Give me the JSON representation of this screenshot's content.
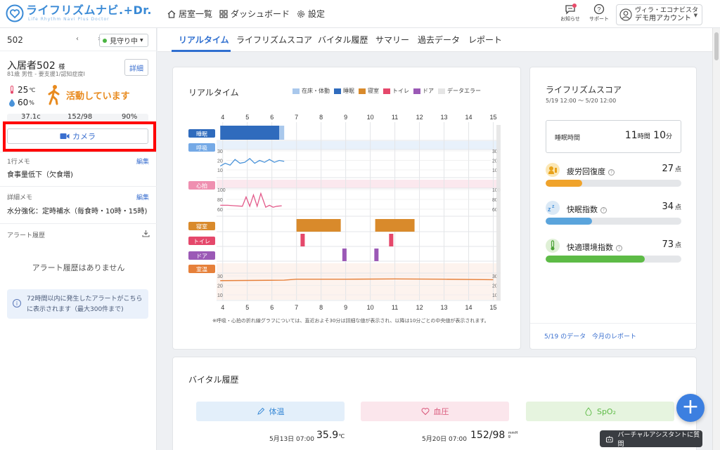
{
  "header": {
    "logo_main": "ライフリズムナビ.+Dr.",
    "logo_sub": "Life Rhythm Navi Plus Doctor",
    "nav": [
      {
        "label": "居室一覧",
        "icon": "home-icon"
      },
      {
        "label": "ダッシュボード",
        "icon": "grid-icon"
      },
      {
        "label": "設定",
        "icon": "gear-icon"
      }
    ],
    "notice_label": "お知らせ",
    "support_label": "サポート",
    "account_line1": "ヴィラ・エコナビスタ",
    "account_line2": "デモ用アカウント"
  },
  "sidebar": {
    "room_no": "502",
    "arrows": "‹ ›",
    "watch_status": "見守り中",
    "resident_name": "入居者502",
    "resident_suffix": "様",
    "resident_info": "81歳 男性 - 要支援1/認知症度I",
    "detail_label": "詳細",
    "temp_value": "25",
    "temp_unit": "℃",
    "humidity_value": "60",
    "humidity_unit": "%",
    "activity_text": "活動しています",
    "vital_temp": "37.1c",
    "vital_bp": "152/98",
    "vital_spo2": "90%",
    "camera_label": "カメラ",
    "memo1_label": "1行メモ",
    "memo1_edit": "編集",
    "memo1_text": "食事量低下（欠食増)",
    "memo2_label": "詳細メモ",
    "memo2_edit": "編集",
    "memo2_text": "水分強化：定時補水（毎食時・10時・15時)",
    "alert_label": "アラート履歴",
    "alert_none": "アラート履歴はありません",
    "alert_info_line1": "72時間以内に発生したアラートがこちら",
    "alert_info_line2": "に表示されます（最大300件まで)"
  },
  "tabs": [
    "リアルタイム",
    "ライフリズムスコア",
    "バイタル履歴",
    "サマリー",
    "過去データ",
    "レポート"
  ],
  "realtime": {
    "title": "リアルタイム",
    "legend": [
      {
        "label": "在床・体動",
        "color": "#a9c8ec"
      },
      {
        "label": "睡眠",
        "color": "#2f6bbd"
      },
      {
        "label": "寝室",
        "color": "#d98a2b"
      },
      {
        "label": "トイレ",
        "color": "#e5486b"
      },
      {
        "label": "ドア",
        "color": "#9b59b6"
      },
      {
        "label": "データエラー",
        "color": "#e5e5e5"
      }
    ],
    "note": "※呼吸・心拍の折れ線グラフについては、直近およそ30分は詳細な値が表示され、以降は10分ごとの中央値が表示されます。"
  },
  "chart_data": {
    "type": "line",
    "x_hours": [
      4,
      5,
      6,
      7,
      8,
      9,
      10,
      11,
      12,
      13,
      14,
      15
    ],
    "row_labels": [
      "睡眠",
      "呼吸",
      "心拍",
      "寝室",
      "トイレ",
      "ドア",
      "室温"
    ],
    "sleep_segments": [
      {
        "from": 3.9,
        "to": 6.3,
        "kind": "睡眠"
      },
      {
        "from": 6.3,
        "to": 6.5,
        "kind": "在床・体動"
      }
    ],
    "breath_scale": [
      30,
      20,
      10
    ],
    "breath": {
      "x": [
        3.9,
        4.1,
        4.3,
        4.5,
        4.7,
        4.9,
        5.1,
        5.3,
        5.5,
        5.7,
        5.9,
        6.1,
        6.3,
        6.5
      ],
      "y": [
        14,
        17,
        15,
        21,
        17,
        18,
        22,
        17,
        20,
        18,
        21,
        18,
        20,
        19
      ]
    },
    "heart_scale": [
      100,
      80,
      60
    ],
    "heart": {
      "x": [
        3.9,
        4.2,
        4.5,
        4.8,
        4.95,
        5.1,
        5.25,
        5.4,
        5.55,
        5.75,
        5.9,
        6.05,
        6.2,
        6.4
      ],
      "y": [
        68,
        68,
        67,
        66,
        85,
        66,
        89,
        66,
        92,
        64,
        68,
        64,
        66,
        67
      ]
    },
    "bedroom_segments": [
      {
        "from": 7.0,
        "to": 8.8
      },
      {
        "from": 10.2,
        "to": 11.8
      }
    ],
    "toilet_events": [
      7.25,
      10.85
    ],
    "door_events": [
      8.95,
      10.25
    ],
    "roomtemp_scale": [
      30,
      20,
      10
    ],
    "roomtemp": {
      "x": [
        3.9,
        6.5,
        7.0,
        9.0,
        11.0,
        13.0,
        15.0
      ],
      "y": [
        25,
        25.5,
        26.5,
        26.5,
        26.8,
        26.5,
        26
      ]
    }
  },
  "score": {
    "title": "ライフリズムスコア",
    "period": "5/19 12:00 〜 5/20 12:00",
    "sleep_label": "睡眠時間",
    "sleep_hours": "11",
    "sleep_hours_unit": "時間",
    "sleep_minutes": "10",
    "sleep_minutes_unit": "分",
    "items": [
      {
        "name": "疲労回復度",
        "value": "27",
        "unit": "点",
        "fraction": 0.27,
        "color": "#f0a32b",
        "icon_bg": "#fbe7b5"
      },
      {
        "name": "快眠指数",
        "value": "34",
        "unit": "点",
        "fraction": 0.34,
        "color": "#5aa4dc",
        "icon_bg": "#dbe9f6"
      },
      {
        "name": "快適環境指数",
        "value": "73",
        "unit": "点",
        "fraction": 0.73,
        "color": "#5dbb46",
        "icon_bg": "#dff0d6"
      }
    ],
    "link1": "5/19 のデータ",
    "link2": "今月のレポート"
  },
  "vitals": {
    "title": "バイタル履歴",
    "tabs": [
      {
        "label": "体温",
        "color": "#3a8ad6",
        "bg": "#e3effa"
      },
      {
        "label": "血圧",
        "color": "#d9577a",
        "bg": "#fbe6ec"
      },
      {
        "label": "SpO₂",
        "color": "#5dbb46",
        "bg": "#e6f4df"
      }
    ],
    "temp_date": "5月13日 07:00",
    "temp_value": "35.9",
    "temp_unit": "℃",
    "bp_date": "5月20日 07:00",
    "bp_value": "152/98",
    "bp_unit": "mmHg"
  },
  "assistant_label": "バーチャルアシスタントに質問",
  "fab_label": "+"
}
